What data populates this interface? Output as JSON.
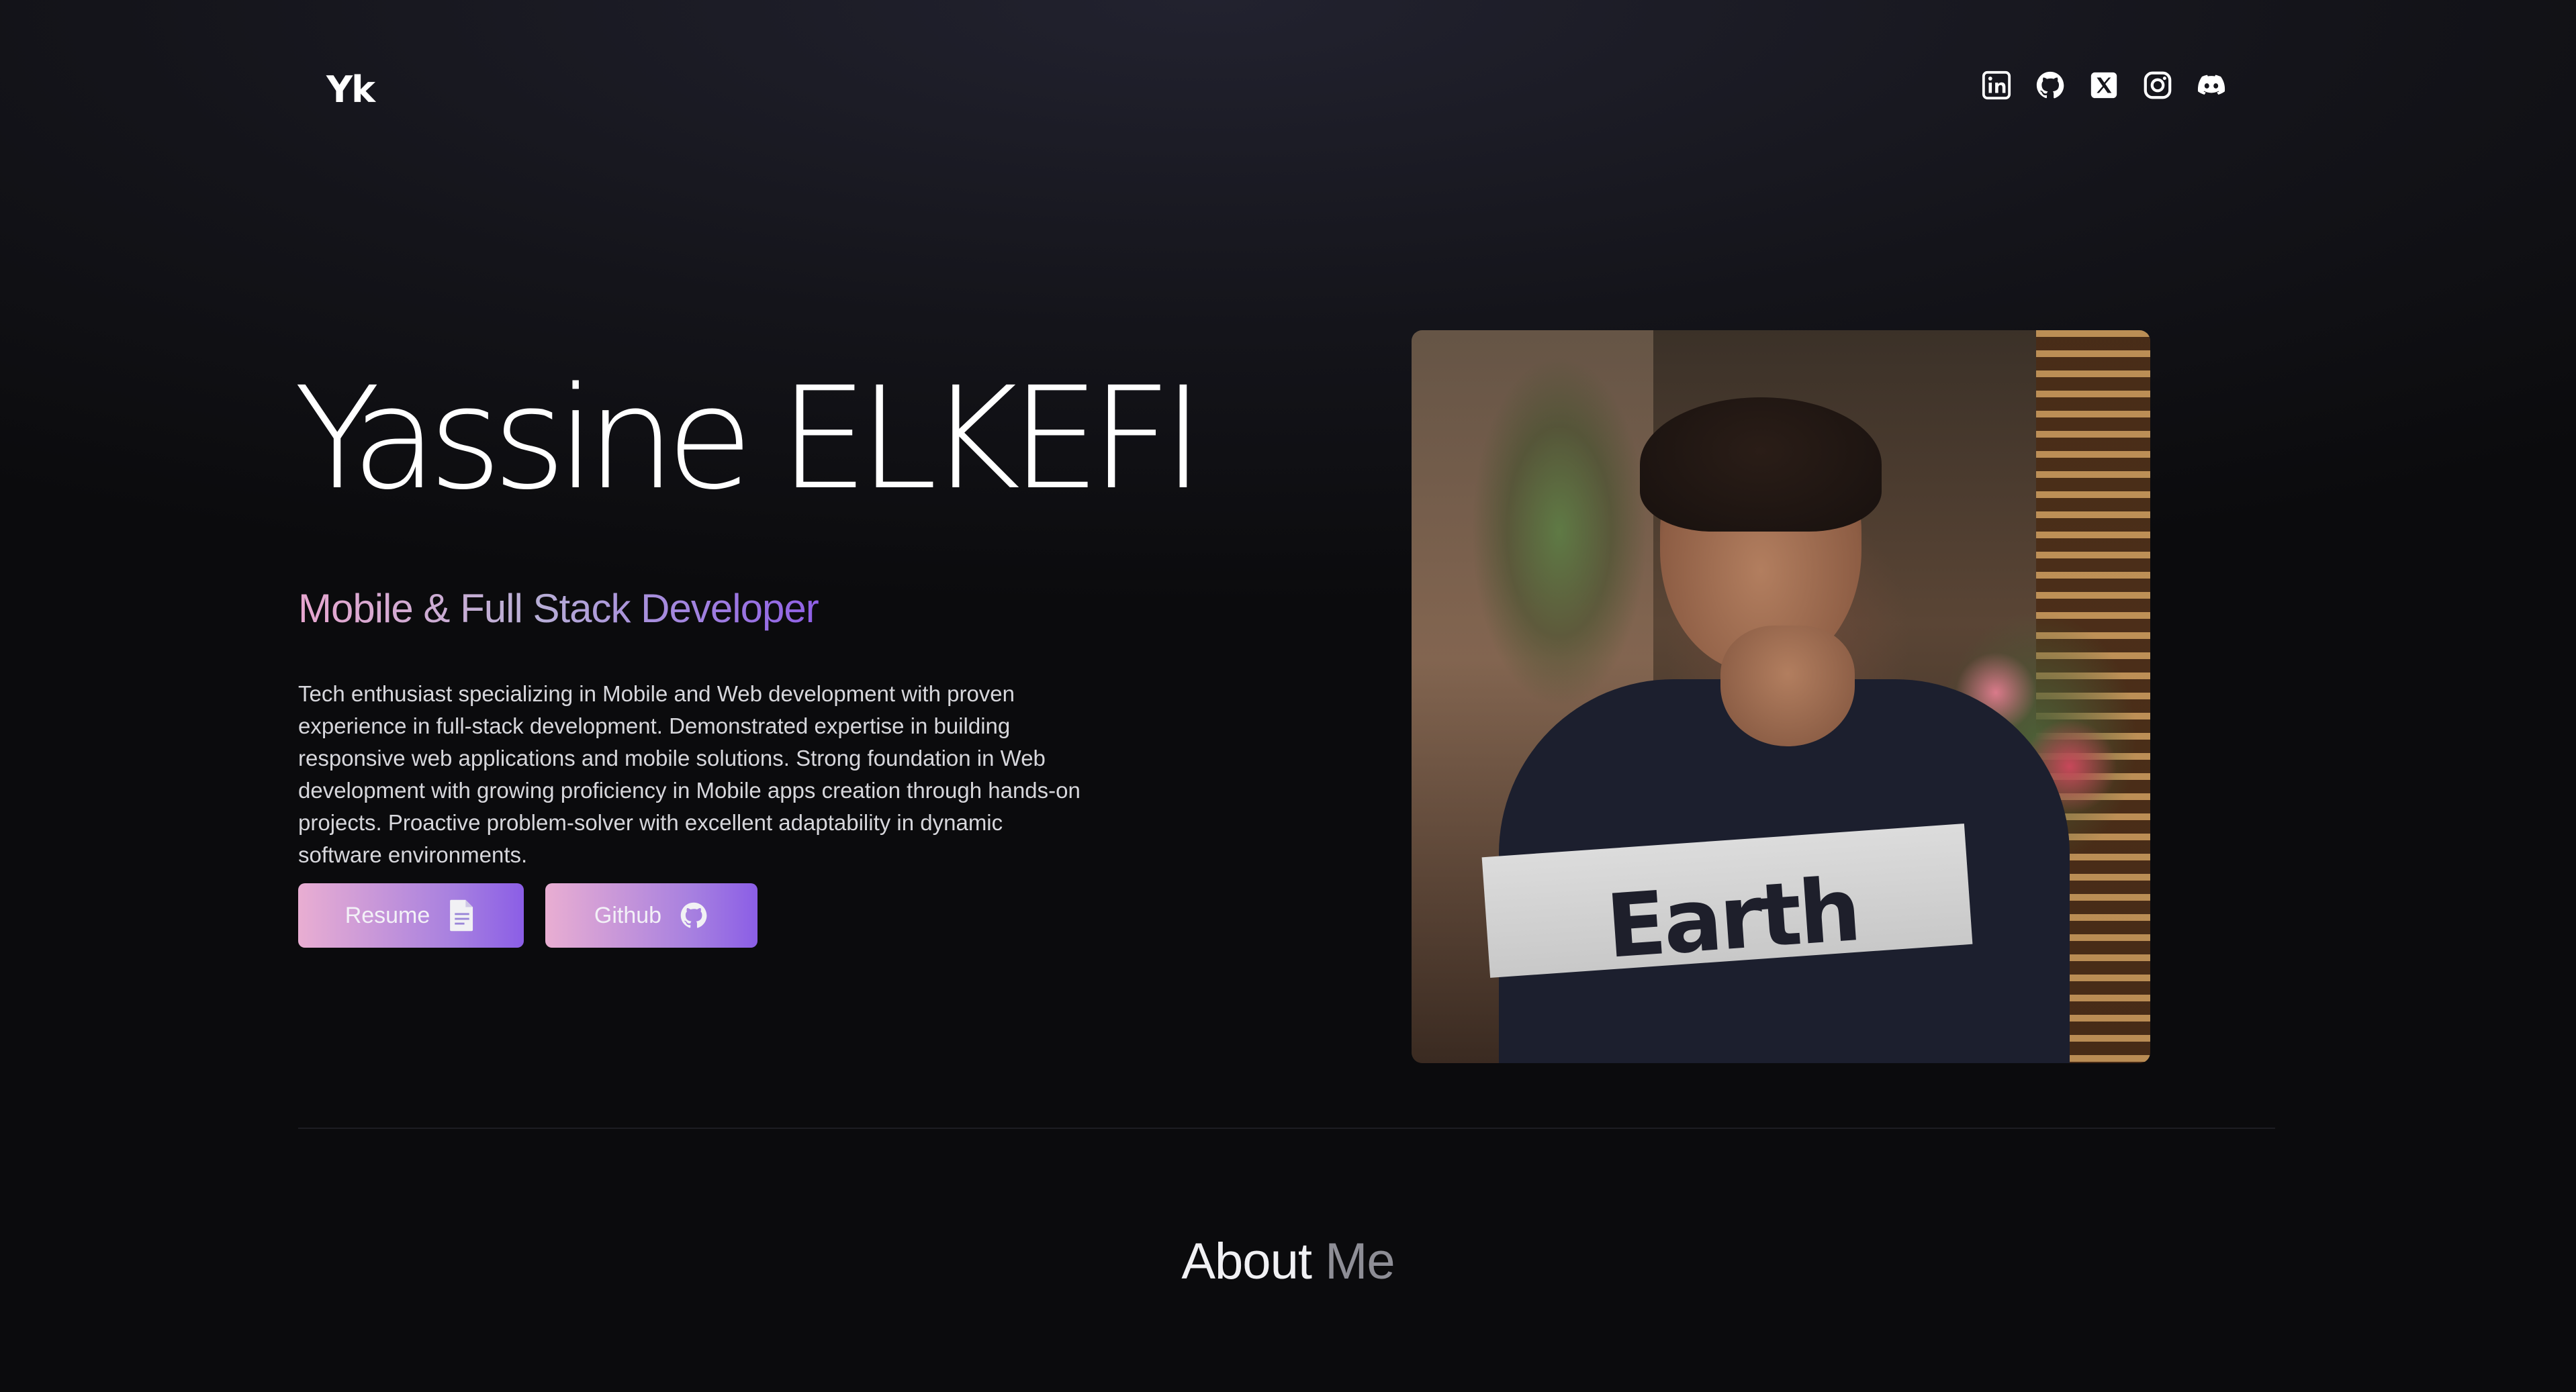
{
  "header": {
    "logo": "Yk",
    "socials": [
      {
        "name": "linkedin-icon"
      },
      {
        "name": "github-icon"
      },
      {
        "name": "x-twitter-icon"
      },
      {
        "name": "instagram-icon"
      },
      {
        "name": "discord-icon"
      }
    ]
  },
  "hero": {
    "name": "Yassine ELKEFI",
    "role": "Mobile & Full Stack Developer",
    "description": "Tech enthusiast specializing in Mobile and Web development with proven experience in full-stack development. Demonstrated expertise in building responsive web applications and mobile solutions. Strong foundation in Web development with growing proficiency in Mobile apps creation through hands-on projects. Proactive problem-solver with excellent adaptability in dynamic software environments.",
    "buttons": {
      "resume_label": "Resume",
      "resume_icon": "document-icon",
      "github_label": "Github",
      "github_icon": "github-icon"
    },
    "photo_icon": "profile-photo"
  },
  "about": {
    "title_word1": "About",
    "title_word2": "Me"
  },
  "colors": {
    "background": "#0b0b0d",
    "accent_pink": "#e9aed2",
    "accent_purple": "#8b5ee6"
  }
}
